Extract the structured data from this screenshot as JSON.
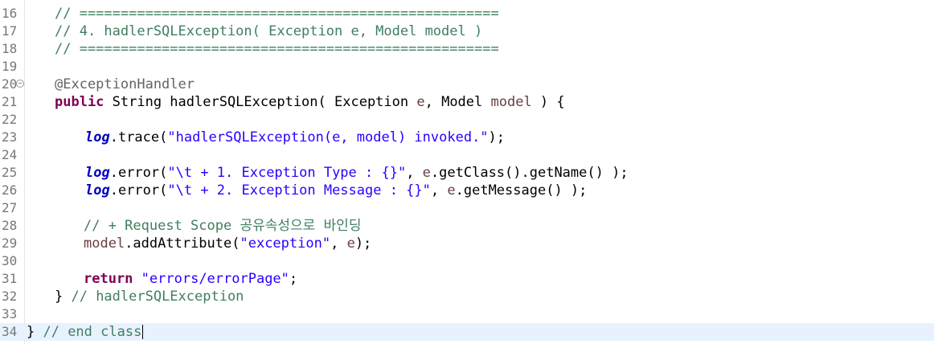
{
  "editor": {
    "lines": [
      {
        "n": "16",
        "parts": [
          {
            "c": "cm",
            "t": "// ==================================================="
          }
        ]
      },
      {
        "n": "17",
        "parts": [
          {
            "c": "cm",
            "t": "// 4. hadlerSQLException( Exception e, Model model )"
          }
        ]
      },
      {
        "n": "18",
        "parts": [
          {
            "c": "cm",
            "t": "// ==================================================="
          }
        ]
      },
      {
        "n": "19",
        "parts": []
      },
      {
        "n": "20",
        "fold": true,
        "parts": [
          {
            "c": "an",
            "t": "@ExceptionHandler"
          }
        ]
      },
      {
        "n": "21",
        "parts": [
          {
            "c": "kw",
            "t": "public"
          },
          {
            "c": "",
            "t": " String hadlerSQLException( Exception "
          },
          {
            "c": "lv",
            "t": "e"
          },
          {
            "c": "",
            "t": ", Model "
          },
          {
            "c": "lv",
            "t": "model"
          },
          {
            "c": "",
            "t": " ) {"
          }
        ]
      },
      {
        "n": "22",
        "parts": []
      },
      {
        "n": "23",
        "parts": [
          {
            "c": "fld",
            "t": "log"
          },
          {
            "c": "",
            "t": ".trace("
          },
          {
            "c": "st",
            "t": "\"hadlerSQLException(e, model) invoked.\""
          },
          {
            "c": "",
            "t": ");"
          }
        ]
      },
      {
        "n": "24",
        "parts": []
      },
      {
        "n": "25",
        "parts": [
          {
            "c": "fld",
            "t": "log"
          },
          {
            "c": "",
            "t": ".error("
          },
          {
            "c": "st",
            "t": "\"\\t + 1. Exception Type : {}\""
          },
          {
            "c": "",
            "t": ", "
          },
          {
            "c": "lv",
            "t": "e"
          },
          {
            "c": "",
            "t": ".getClass().getName() );"
          }
        ]
      },
      {
        "n": "26",
        "parts": [
          {
            "c": "fld",
            "t": "log"
          },
          {
            "c": "",
            "t": ".error("
          },
          {
            "c": "st",
            "t": "\"\\t + 2. Exception Message : {}\""
          },
          {
            "c": "",
            "t": ", "
          },
          {
            "c": "lv",
            "t": "e"
          },
          {
            "c": "",
            "t": ".getMessage() );"
          }
        ]
      },
      {
        "n": "27",
        "parts": []
      },
      {
        "n": "28",
        "parts": [
          {
            "c": "cm",
            "t": "// + Request Scope 공유속성으로 바인딩"
          }
        ]
      },
      {
        "n": "29",
        "parts": [
          {
            "c": "lv",
            "t": "model"
          },
          {
            "c": "",
            "t": ".addAttribute("
          },
          {
            "c": "st",
            "t": "\"exception\""
          },
          {
            "c": "",
            "t": ", "
          },
          {
            "c": "lv",
            "t": "e"
          },
          {
            "c": "",
            "t": ");"
          }
        ]
      },
      {
        "n": "30",
        "parts": []
      },
      {
        "n": "31",
        "parts": [
          {
            "c": "kw",
            "t": "return"
          },
          {
            "c": "",
            "t": " "
          },
          {
            "c": "st",
            "t": "\"errors/errorPage\""
          },
          {
            "c": "",
            "t": ";"
          }
        ]
      },
      {
        "n": "32",
        "parts": [
          {
            "c": "",
            "t": "} "
          },
          {
            "c": "cm",
            "t": "// hadlerSQLException"
          }
        ]
      },
      {
        "n": "33",
        "parts": []
      },
      {
        "n": "34",
        "current": true,
        "caret": true,
        "parts": [
          {
            "c": "",
            "t": "} "
          },
          {
            "c": "cm",
            "t": "// end class"
          }
        ]
      }
    ]
  }
}
